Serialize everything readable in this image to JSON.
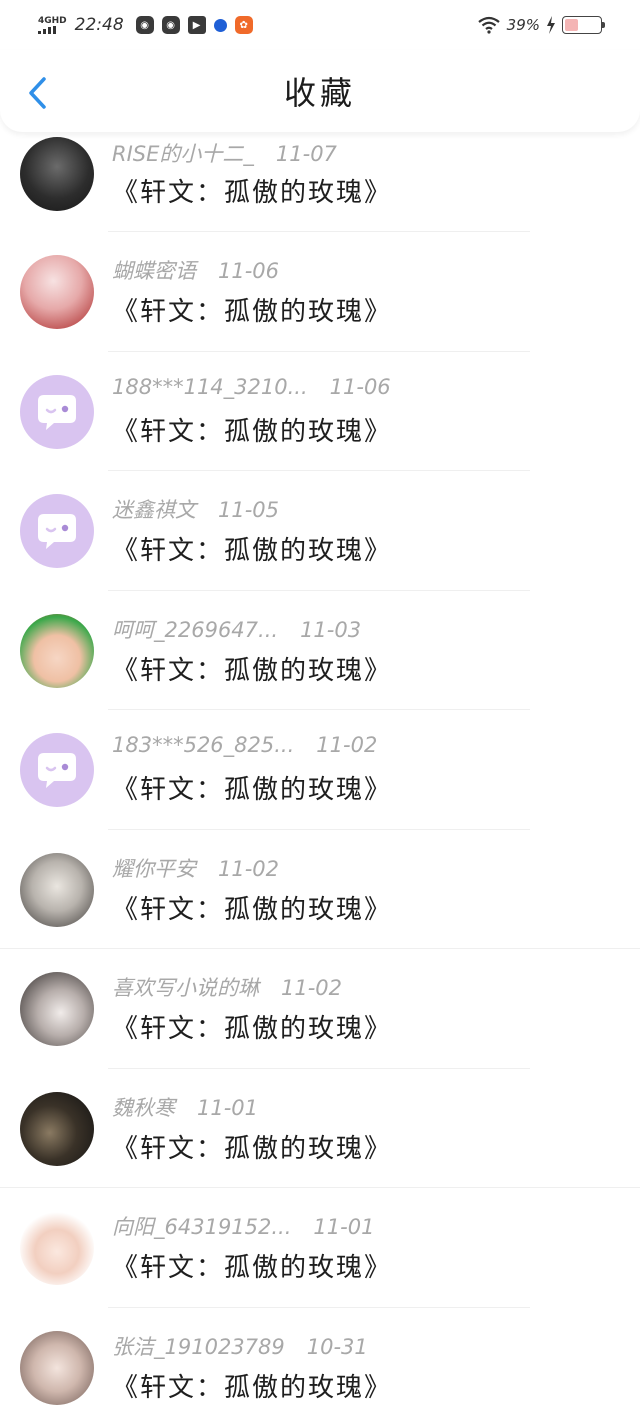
{
  "status_bar": {
    "network": "4GHD",
    "time": "22:48",
    "battery_percent": "39%",
    "battery_level": 0.39
  },
  "header": {
    "title": "收藏",
    "back_icon": "chevron-left-icon",
    "accent_color": "#2f8fe8"
  },
  "favorites": [
    {
      "user": "RISE的小十二_",
      "date": "11-07",
      "work": "《轩文：孤傲的玫瑰》",
      "avatar": "group-photo"
    },
    {
      "user": "蝴蝶密语",
      "date": "11-06",
      "work": "《轩文：孤傲的玫瑰》",
      "avatar": "anime-pink"
    },
    {
      "user": "188***114_3210...",
      "date": "11-06",
      "work": "《轩文：孤傲的玫瑰》",
      "avatar": "default-chat"
    },
    {
      "user": "迷鑫祺文",
      "date": "11-05",
      "work": "《轩文：孤傲的玫瑰》",
      "avatar": "default-chat"
    },
    {
      "user": "呵呵_2269647...",
      "date": "11-03",
      "work": "《轩文：孤傲的玫瑰》",
      "avatar": "baby-photo"
    },
    {
      "user": "183***526_825...",
      "date": "11-02",
      "work": "《轩文：孤傲的玫瑰》",
      "avatar": "default-chat"
    },
    {
      "user": "耀你平安",
      "date": "11-02",
      "work": "《轩文：孤傲的玫瑰》",
      "avatar": "person-photo"
    },
    {
      "user": "喜欢写小说的琳",
      "date": "11-02",
      "work": "《轩文：孤傲的玫瑰》",
      "avatar": "girl-photo"
    },
    {
      "user": "魏秋寒",
      "date": "11-01",
      "work": "《轩文：孤傲的玫瑰》",
      "avatar": "dark-photo"
    },
    {
      "user": "向阳_64319152...",
      "date": "11-01",
      "work": "《轩文：孤傲的玫瑰》",
      "avatar": "cartoon-girl"
    },
    {
      "user": "张洁_191023789",
      "date": "10-31",
      "work": "《轩文：孤傲的玫瑰》",
      "avatar": "woman-photo"
    }
  ]
}
